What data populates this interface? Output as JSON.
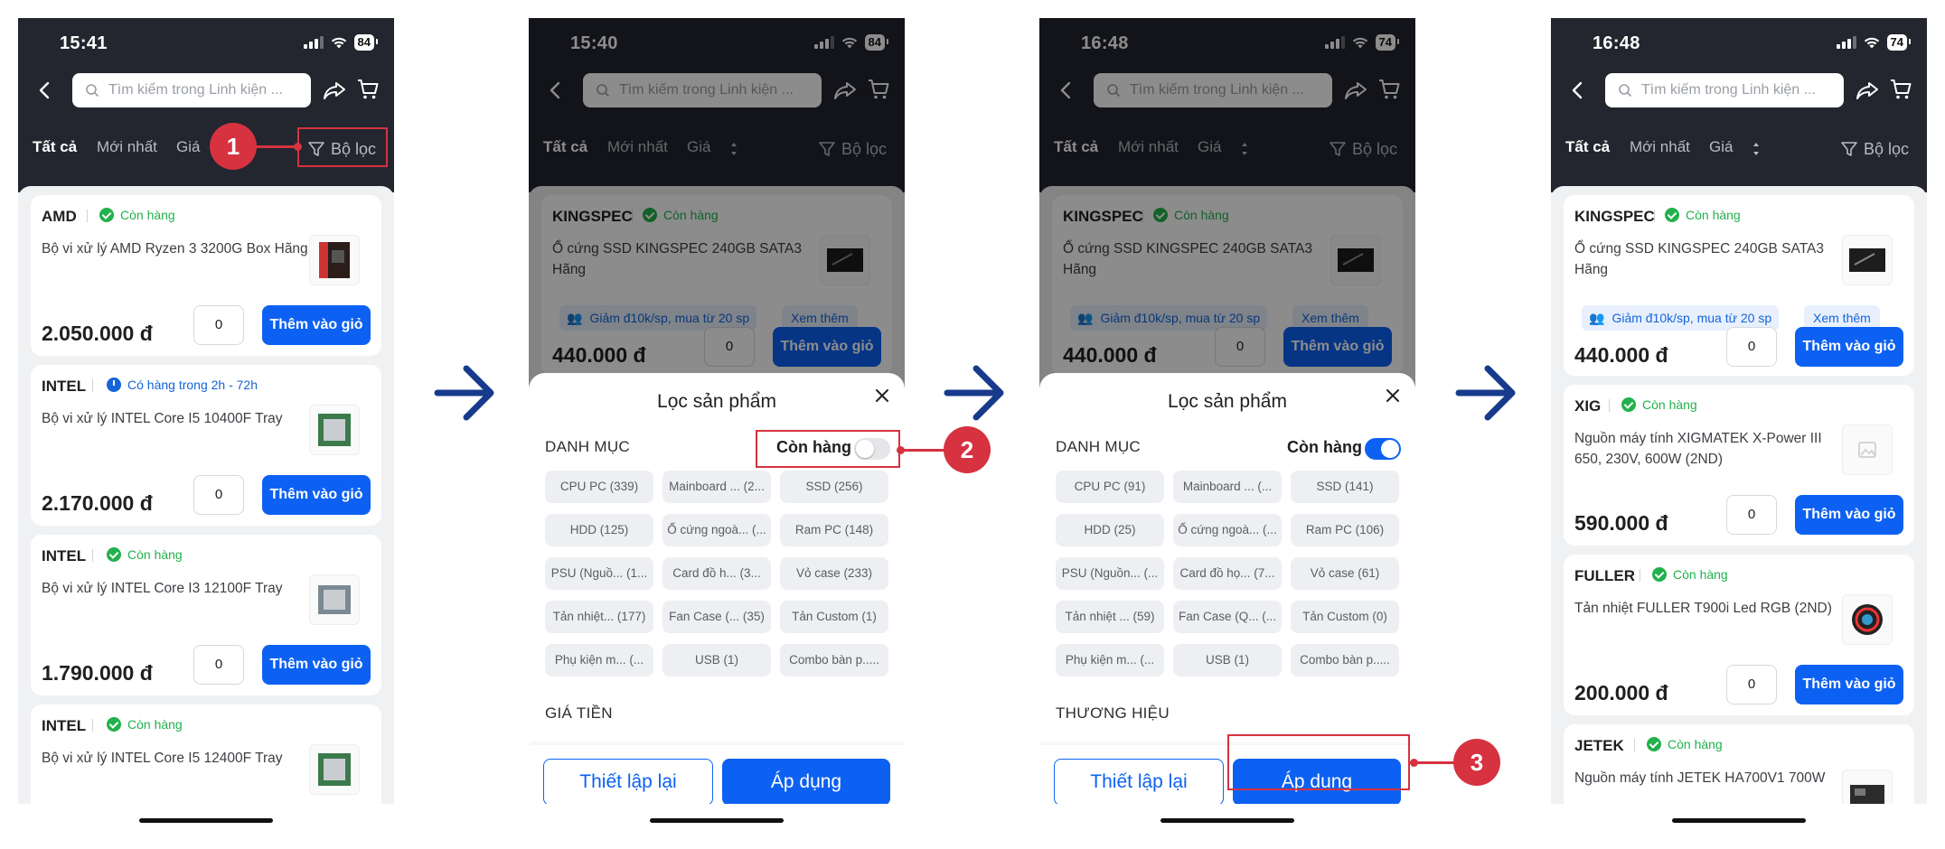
{
  "screens": [
    {
      "time": "15:41",
      "battery": "84",
      "search_placeholder": "Tìm kiếm trong Linh kiện ...",
      "tabs": {
        "all": "Tất cả",
        "newest": "Mới nhất",
        "price": "Giá",
        "filter": "Bộ lọc"
      },
      "products": [
        {
          "brand": "AMD",
          "stock": "Còn hàng",
          "name": "Bộ vi xử lý AMD Ryzen 3 3200G Box Hãng",
          "qty": "0",
          "price": "2.050.000 đ",
          "add": "Thêm vào giỏ"
        },
        {
          "brand": "INTEL",
          "stock": "Có hàng trong 2h - 72h",
          "name": "Bộ vi xử lý INTEL Core I5 10400F Tray",
          "qty": "0",
          "price": "2.170.000 đ",
          "add": "Thêm vào giỏ"
        },
        {
          "brand": "INTEL",
          "stock": "Còn hàng",
          "name": "Bộ vi xử lý INTEL Core I3 12100F Tray",
          "qty": "0",
          "price": "1.790.000 đ",
          "add": "Thêm vào giỏ"
        },
        {
          "brand": "INTEL",
          "stock": "Còn hàng",
          "name": "Bộ vi xử lý INTEL Core I5 12400F Tray"
        }
      ]
    },
    {
      "time": "15:40",
      "battery": "84",
      "search_placeholder": "Tìm kiếm trong Linh kiện ...",
      "tabs": {
        "all": "Tất cả",
        "newest": "Mới nhất",
        "price": "Giá",
        "filter": "Bộ lọc"
      },
      "product": {
        "brand": "KINGSPEC",
        "stock": "Còn hàng",
        "name": "Ổ cứng SSD KINGSPEC 240GB SATA3 Hãng",
        "promo": "Giảm đ10k/sp, mua từ 20 sp",
        "see_more": "Xem thêm",
        "qty": "0",
        "price": "440.000 đ",
        "add": "Thêm vào giỏ"
      },
      "sheet": {
        "title": "Lọc sản phẩm",
        "category_heading": "DANH MỤC",
        "in_stock_label": "Còn hàng",
        "chips": [
          "CPU PC (339)",
          "Mainboard ... (2...",
          "SSD (256)",
          "HDD (125)",
          "Ổ cứng ngoà... (...",
          "Ram PC (148)",
          "PSU (Nguồ... (1...",
          "Card đồ h... (3...",
          "Vỏ case (233)",
          "Tản nhiệt... (177)",
          "Fan Case (... (35)",
          "Tản Custom (1)",
          "Phụ kiện m... (...",
          "USB (1)",
          "Combo bàn p....."
        ],
        "next_heading": "GIÁ TIỀN",
        "reset": "Thiết lập lại",
        "apply": "Áp dụng"
      }
    },
    {
      "time": "16:48",
      "battery": "74",
      "search_placeholder": "Tìm kiếm trong Linh kiện ...",
      "tabs": {
        "all": "Tất cả",
        "newest": "Mới nhất",
        "price": "Giá",
        "filter": "Bộ lọc"
      },
      "product": {
        "brand": "KINGSPEC",
        "stock": "Còn hàng",
        "name": "Ổ cứng SSD KINGSPEC 240GB SATA3 Hãng",
        "promo": "Giảm đ10k/sp, mua từ 20 sp",
        "see_more": "Xem thêm",
        "qty": "0",
        "price": "440.000 đ",
        "add": "Thêm vào giỏ"
      },
      "sheet": {
        "title": "Lọc sản phẩm",
        "category_heading": "DANH MỤC",
        "in_stock_label": "Còn hàng",
        "chips": [
          "CPU PC (91)",
          "Mainboard ... (...",
          "SSD (141)",
          "HDD (25)",
          "Ổ cứng ngoà... (...",
          "Ram PC (106)",
          "PSU (Nguồn... (...",
          "Card đồ họ... (7...",
          "Vỏ case (61)",
          "Tản nhiệt ... (59)",
          "Fan Case (Q... (...",
          "Tản Custom (0)",
          "Phụ kiện m... (...",
          "USB (1)",
          "Combo bàn p....."
        ],
        "next_heading": "THƯƠNG HIỆU",
        "reset": "Thiết lập lại",
        "apply": "Áp dụng"
      }
    },
    {
      "time": "16:48",
      "battery": "74",
      "search_placeholder": "Tìm kiếm trong Linh kiện ...",
      "tabs": {
        "all": "Tất cả",
        "newest": "Mới nhất",
        "price": "Giá",
        "filter": "Bộ lọc"
      },
      "products": [
        {
          "brand": "KINGSPEC",
          "stock": "Còn hàng",
          "name": "Ổ cứng SSD KINGSPEC 240GB SATA3 Hãng",
          "promo": "Giảm đ10k/sp, mua từ 20 sp",
          "see_more": "Xem thêm",
          "qty": "0",
          "price": "440.000 đ",
          "add": "Thêm vào giỏ"
        },
        {
          "brand": "XIG",
          "stock": "Còn hàng",
          "name": "Nguồn máy tính XIGMATEK X-Power III 650, 230V, 600W (2ND)",
          "qty": "0",
          "price": "590.000 đ",
          "add": "Thêm vào giỏ"
        },
        {
          "brand": "FULLER",
          "stock": "Còn hàng",
          "name": "Tản nhiệt FULLER T900i Led RGB (2ND)",
          "qty": "0",
          "price": "200.000 đ",
          "add": "Thêm vào giỏ"
        },
        {
          "brand": "JETEK",
          "stock": "Còn hàng",
          "name": "Nguồn máy tính JETEK HA700V1 700W"
        }
      ]
    }
  ],
  "steps": [
    "1",
    "2",
    "3"
  ],
  "colors": {
    "primary": "#0d61f2",
    "annotation": "#d63240",
    "header": "#23262e",
    "in_stock": "#22b14c"
  }
}
